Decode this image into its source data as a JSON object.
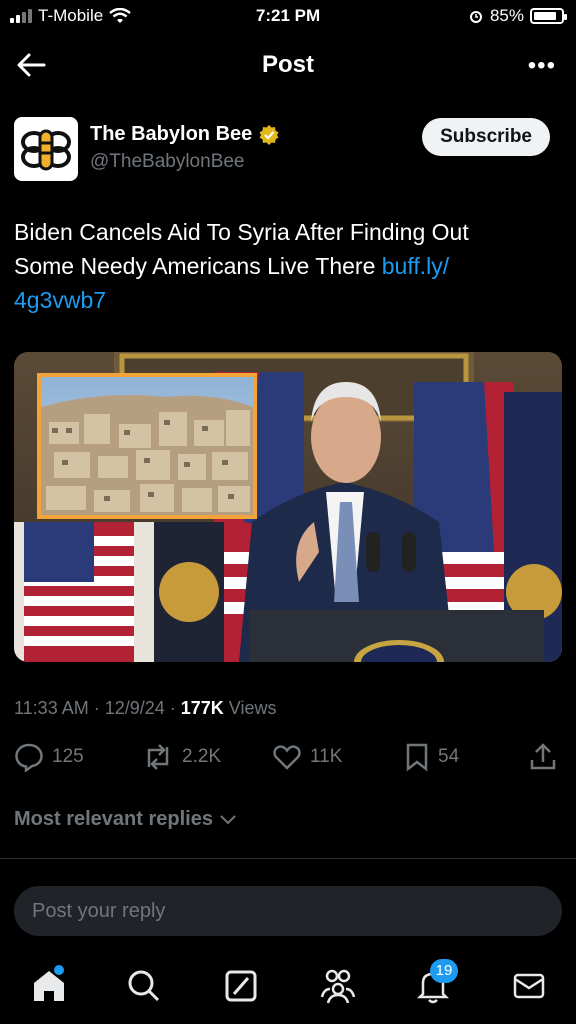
{
  "status_bar": {
    "carrier": "T-Mobile",
    "time": "7:21 PM",
    "battery": "85%"
  },
  "header": {
    "title": "Post"
  },
  "author": {
    "name": "The Babylon Bee",
    "handle": "@TheBabylonBee",
    "subscribe_label": "Subscribe"
  },
  "post": {
    "text_line1": "Biden Cancels Aid To Syria After Finding Out",
    "text_line2": "Some Needy Americans Live There ",
    "link_part1": "buff.ly/",
    "link_part2": "4g3vwb7"
  },
  "meta": {
    "timestamp": "11:33 AM · 12/9/24 · ",
    "views_count": "177K",
    "views_label": " Views"
  },
  "actions": {
    "replies": "125",
    "reposts": "2.2K",
    "likes": "11K",
    "bookmarks": "54"
  },
  "relevant_label": "Most relevant replies",
  "reply_placeholder": "Post your reply",
  "nav": {
    "notifications_badge": "19"
  },
  "colors": {
    "accent": "#1d9bf0",
    "background": "#000000",
    "muted": "#71767b"
  }
}
